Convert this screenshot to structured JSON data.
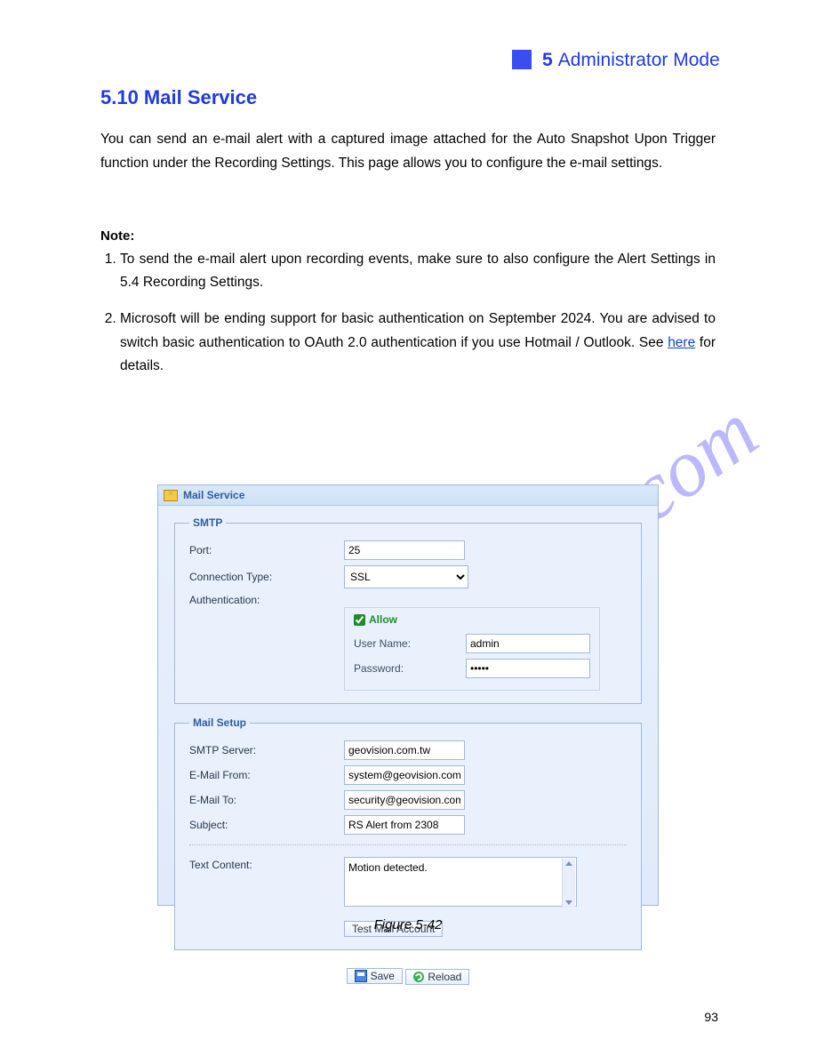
{
  "chapter": {
    "number": "5",
    "title": "Administrator Mode"
  },
  "section": "5.10  Mail Service",
  "paragraphs": {
    "intro": "You can send an e-mail alert with a captured image attached for the Auto Snapshot Upon Trigger function under the Recording Settings. This page allows you to configure the e-mail settings.",
    "notes_label": "Note:",
    "note1": "To send the e-mail alert upon recording events, make sure to also configure the Alert Settings in 5.4 Recording Settings.",
    "note2_a": "Microsoft will be ending support for basic authentication on September 2024. You are advised to switch basic authentication to OAuth 2.0 authentication if you use Hotmail / Outlook. See ",
    "note2_link_text": "here",
    "note2_b": " for details."
  },
  "panel": {
    "title": "Mail Service",
    "smtp": {
      "legend": "SMTP",
      "port_label": "Port:",
      "port_value": "25",
      "conn_label": "Connection Type:",
      "conn_value": "SSL",
      "auth_label": "Authentication:",
      "allow_label": "Allow",
      "allow_checked": true,
      "user_label": "User Name:",
      "user_value": "admin",
      "pass_label": "Password:",
      "pass_value": "•••••"
    },
    "mail": {
      "legend": "Mail Setup",
      "server_label": "SMTP Server:",
      "server_value": "geovision.com.tw",
      "from_label": "E-Mail From:",
      "from_value": "system@geovision.com.tw",
      "to_label": "E-Mail To:",
      "to_value": "security@geovision.com.tw",
      "subject_label": "Subject:",
      "subject_value": "RS Alert from 2308",
      "text_label": "Text Content:",
      "text_value": "Motion detected.",
      "test_btn": "Test Mail Account"
    },
    "buttons": {
      "save": "Save",
      "reload": "Reload"
    }
  },
  "figure": "Figure 5-42",
  "page_number": "93"
}
